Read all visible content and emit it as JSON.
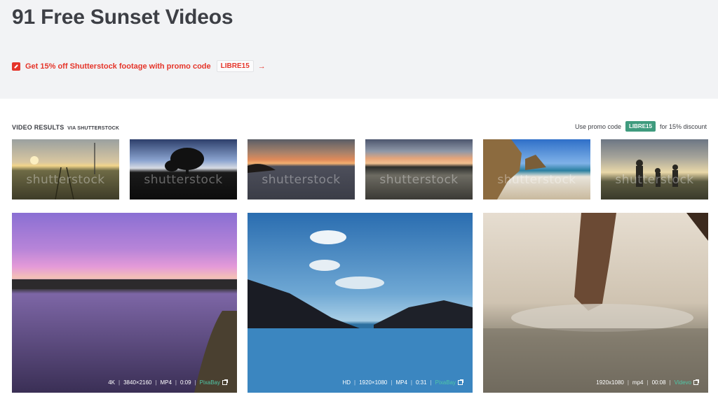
{
  "header": {
    "title": "91 Free Sunset Videos",
    "promo_text": "Get 15% off Shutterstock footage with promo code",
    "promo_code": "LIBRE15",
    "promo_arrow": "→"
  },
  "results": {
    "label": "VIDEO RESULTS",
    "via": "VIA SHUTTERSTOCK",
    "discount_prefix": "Use promo code",
    "discount_code": "LIBRE15",
    "discount_suffix": "for 15% discount"
  },
  "thumbnails": [
    {
      "watermark": "shutterstock"
    },
    {
      "watermark": "shutterstock"
    },
    {
      "watermark": "shutterstock"
    },
    {
      "watermark": "shutterstock"
    },
    {
      "watermark": "shutterstock"
    },
    {
      "watermark": "shutterstock"
    }
  ],
  "videos": [
    {
      "quality": "4K",
      "resolution": "3840×2160",
      "format": "MP4",
      "duration": "0:09",
      "source": "PixaBay"
    },
    {
      "quality": "HD",
      "resolution": "1920×1080",
      "format": "MP4",
      "duration": "0:31",
      "source": "PixaBay"
    },
    {
      "quality": "",
      "resolution": "1920x1080",
      "format": "mp4",
      "duration": "00:08",
      "source": "Videvo"
    }
  ],
  "colors": {
    "promo_red": "#e5352a",
    "code_green": "#3f9b7e",
    "source_green": "#4fc7a8"
  }
}
